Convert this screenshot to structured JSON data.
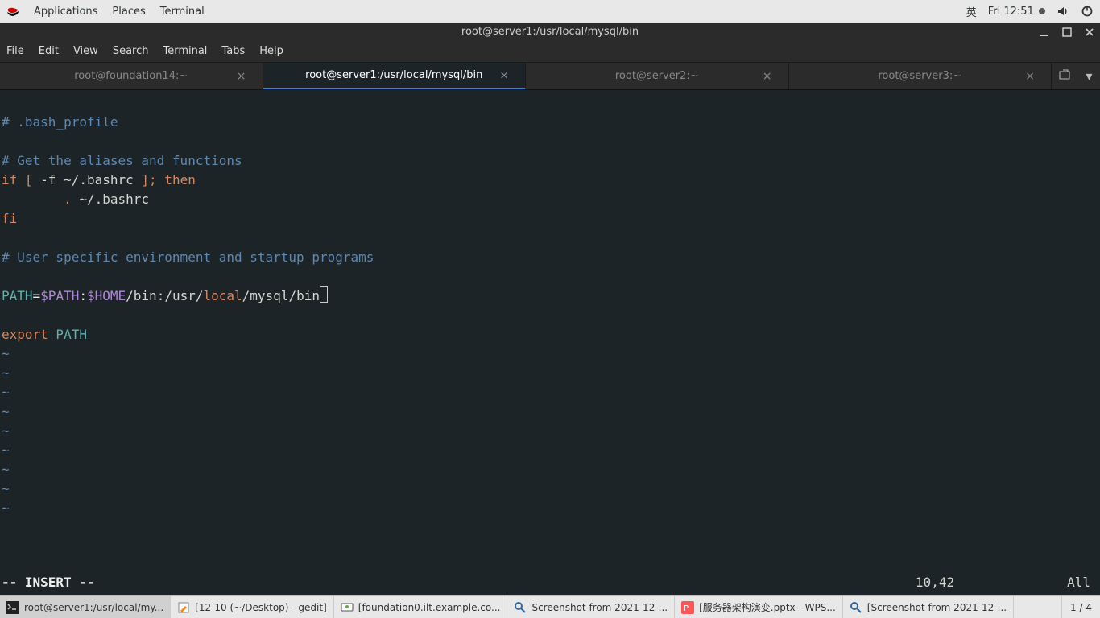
{
  "top_panel": {
    "apps": "Applications",
    "places": "Places",
    "terminal": "Terminal",
    "ime": "英",
    "clock": "Fri 12:51"
  },
  "window": {
    "title": "root@server1:/usr/local/mysql/bin"
  },
  "menu": {
    "file": "File",
    "edit": "Edit",
    "view": "View",
    "search": "Search",
    "terminal": "Terminal",
    "tabs": "Tabs",
    "help": "Help"
  },
  "tabs": [
    {
      "label": "root@foundation14:~",
      "active": false
    },
    {
      "label": "root@server1:/usr/local/mysql/bin",
      "active": true
    },
    {
      "label": "root@server2:~",
      "active": false
    },
    {
      "label": "root@server3:~",
      "active": false
    }
  ],
  "editor": {
    "l1": "# .bash_profile",
    "l3": "# Get the aliases and functions",
    "l4_if": "if",
    "l4_lb": " [ ",
    "l4_flag": "-f",
    "l4_path": " ~/.bashrc ",
    "l4_rb": "];",
    "l4_then": " then",
    "l5_dot": "        . ",
    "l5_path": "~/.bashrc",
    "l6_fi": "fi",
    "l8": "# User specific environment and startup programs",
    "l10_path": "PATH",
    "l10_eq": "=",
    "l10_dpath": "$PATH",
    "l10_colon": ":",
    "l10_home": "$HOME",
    "l10_rest1": "/bin:/usr/",
    "l10_local": "local",
    "l10_rest2": "/mysql/bin",
    "l12_export": "export",
    "l12_path": " PATH",
    "tilde": "~",
    "mode": "-- INSERT --",
    "pos": "10,42",
    "scroll": "All"
  },
  "taskbar": {
    "items": [
      {
        "label": "root@server1:/usr/local/my...",
        "icon": "terminal",
        "active": true
      },
      {
        "label": "[12-10 (~/Desktop) - gedit]",
        "icon": "gedit",
        "active": false
      },
      {
        "label": "[foundation0.ilt.example.co...",
        "icon": "vm",
        "active": false
      },
      {
        "label": "Screenshot from 2021-12-...",
        "icon": "viewer",
        "active": false
      },
      {
        "label": "[服务器架构演变.pptx - WPS...",
        "icon": "wps",
        "active": false
      },
      {
        "label": "[Screenshot from 2021-12-...",
        "icon": "viewer",
        "active": false
      }
    ],
    "workspace": "1 / 4"
  }
}
